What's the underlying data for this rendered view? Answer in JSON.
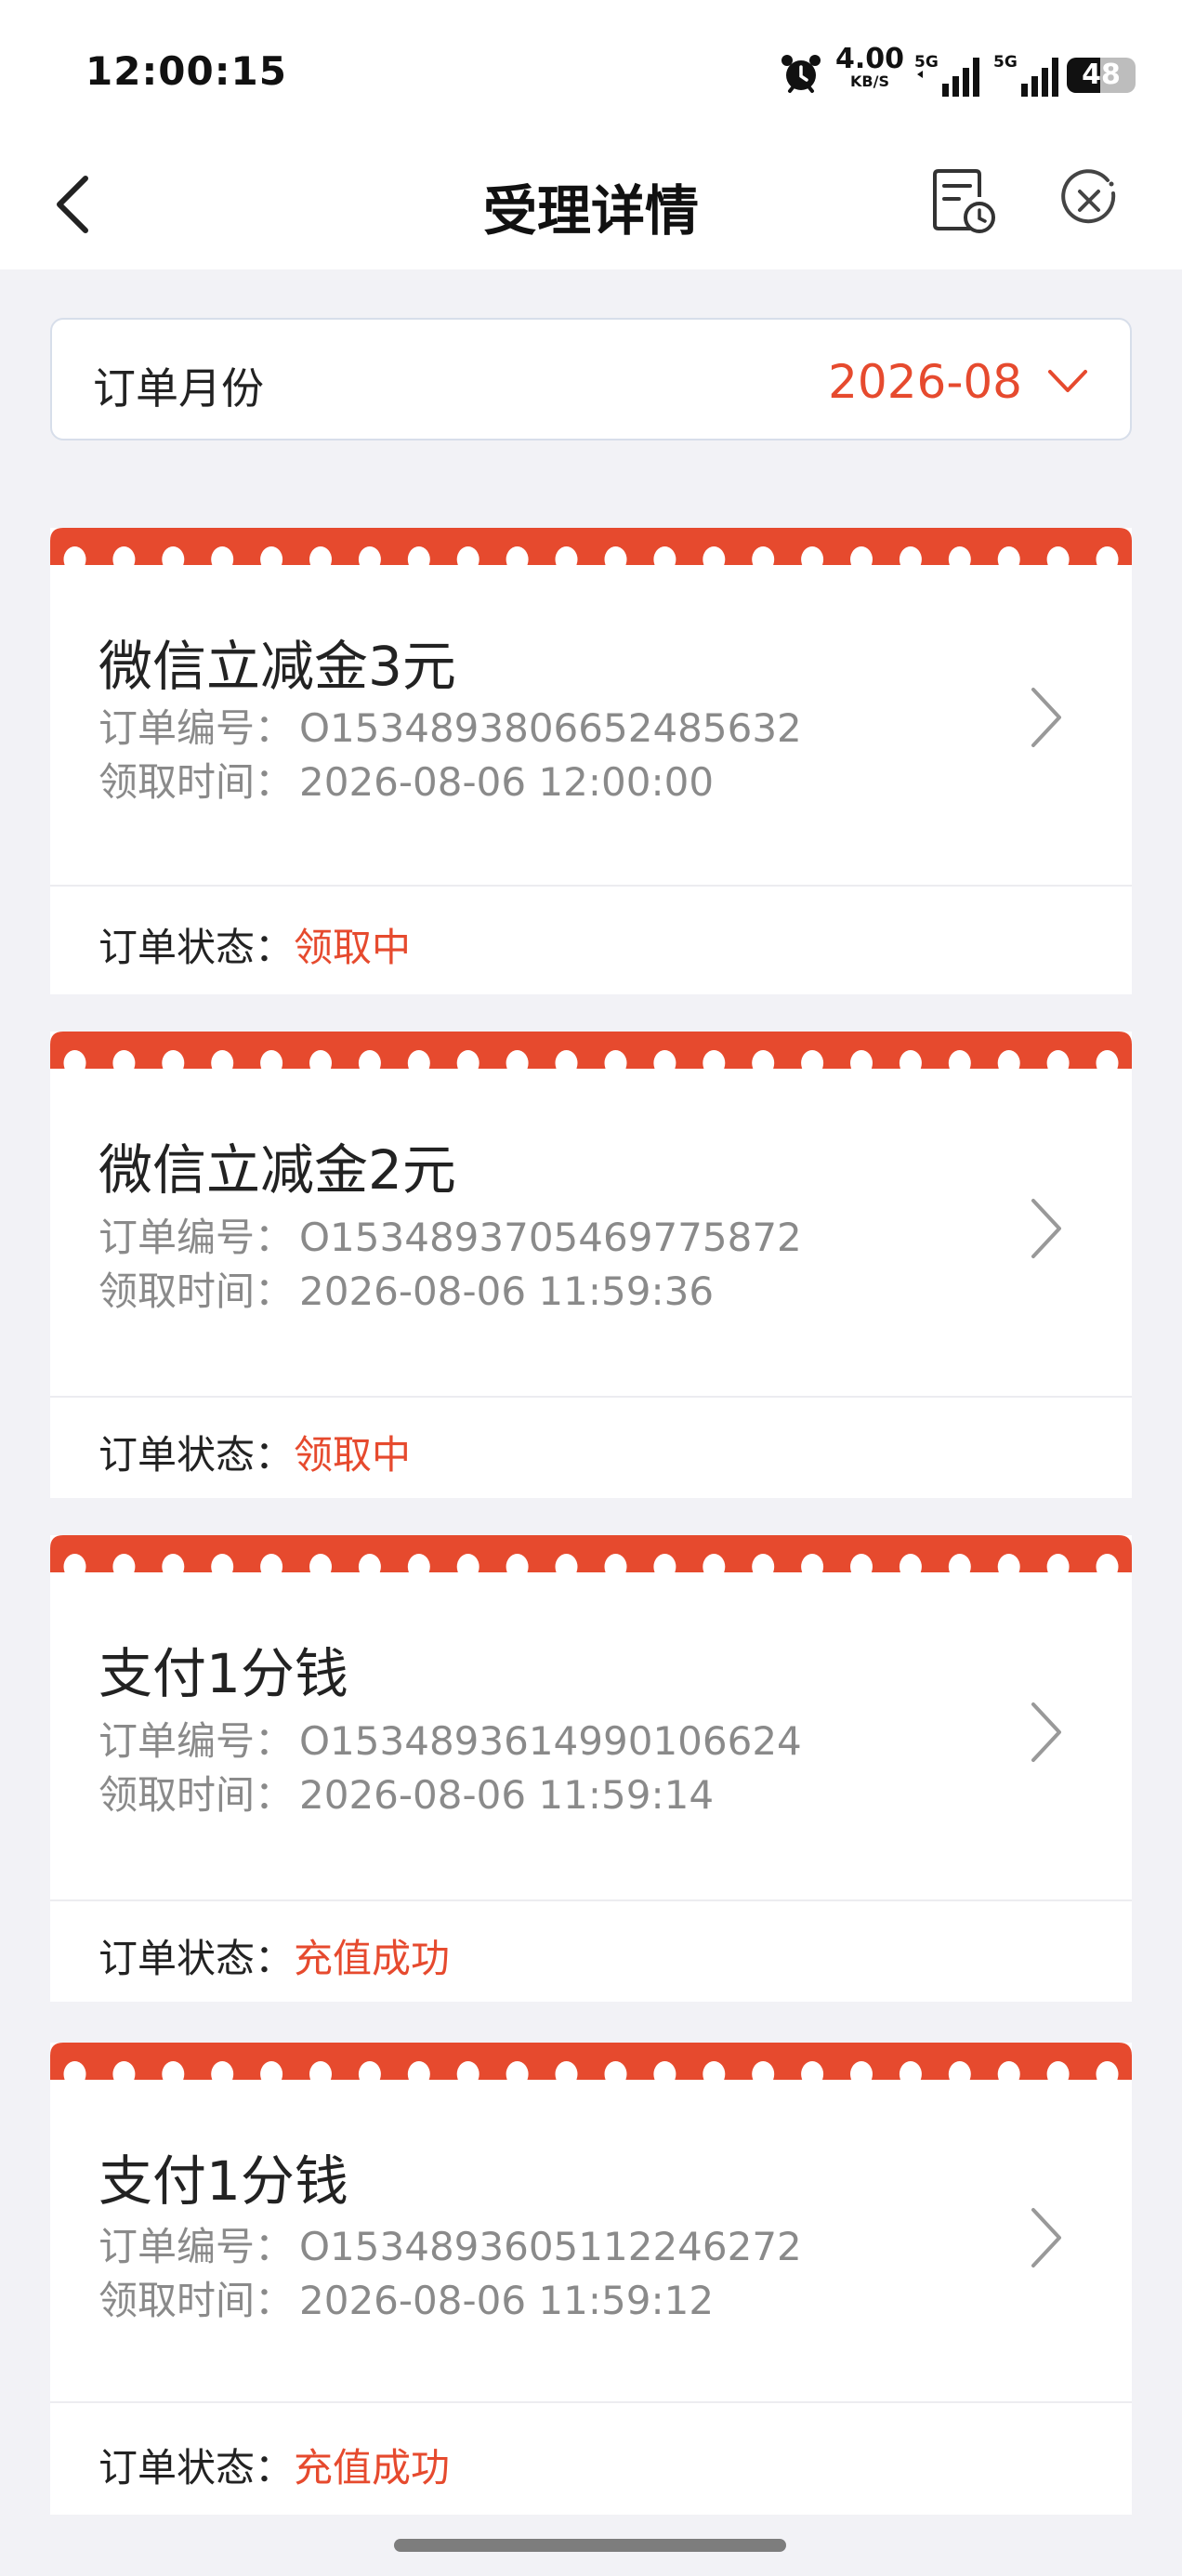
{
  "status_bar": {
    "time": "12:00:15",
    "net_speed": "4.00",
    "net_unit": "KB/S",
    "signal1_label": "5G",
    "signal2_label": "5G",
    "battery": "48"
  },
  "nav": {
    "title": "受理详情",
    "icons": [
      "back-arrow-icon",
      "document-clock-icon",
      "close-circle-icon"
    ]
  },
  "month_filter": {
    "label": "订单月份",
    "value": "2026-08"
  },
  "order_labels": {
    "number": "订单编号：",
    "time": "领取时间：",
    "status": "订单状态："
  },
  "orders": [
    {
      "title": "微信立减金3元",
      "number": "O153489380665248563​2",
      "time": "2026-08-06 12:00:00",
      "status": "领取中"
    },
    {
      "title": "微信立减金2元",
      "number": "O15348937054697758​72",
      "time": "2026-08-06 11:59:36",
      "status": "领取中"
    },
    {
      "title": "支付1分钱",
      "number": "O15348936149901066​24",
      "time": "2026-08-06 11:59:14",
      "status": "充值成功"
    },
    {
      "title": "支付1分钱",
      "number": "O15348936051122462​72",
      "time": "2026-08-06 11:59:12",
      "status": "充值成功"
    }
  ],
  "colors": {
    "accent": "#e64a2e",
    "background": "#f2f2f6",
    "muted_text": "#8a8a8a"
  }
}
